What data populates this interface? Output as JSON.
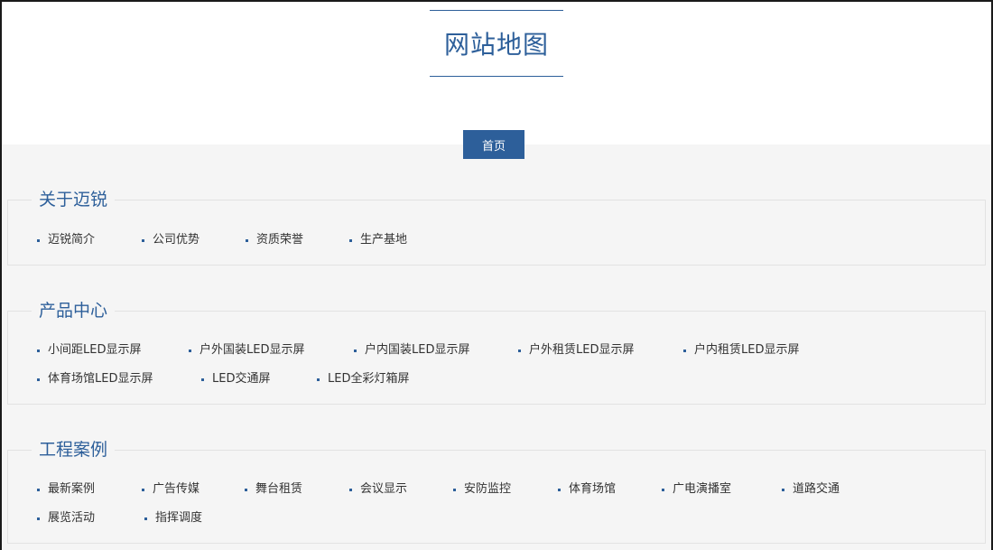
{
  "header": {
    "title": "网站地图"
  },
  "home_button": "首页",
  "sections": [
    {
      "title": "关于迈锐",
      "rows": [
        [
          "迈锐简介",
          "公司优势",
          "资质荣誉",
          "生产基地"
        ]
      ]
    },
    {
      "title": "产品中心",
      "rows": [
        [
          "小间距LED显示屏",
          "户外国装LED显示屏",
          "户内国装LED显示屏",
          "户外租赁LED显示屏",
          "户内租赁LED显示屏"
        ],
        [
          "体育场馆LED显示屏",
          "LED交通屏",
          "LED全彩灯箱屏"
        ]
      ]
    },
    {
      "title": "工程案例",
      "rows": [
        [
          "最新案例",
          "广告传媒",
          "舞台租赁",
          "会议显示",
          "安防监控",
          "体育场馆",
          "广电演播室",
          "道路交通"
        ],
        [
          "展览活动",
          "指挥调度"
        ]
      ]
    }
  ],
  "colors": {
    "accent": "#2d5f9a",
    "background": "#f5f5f5",
    "text": "#333333"
  }
}
